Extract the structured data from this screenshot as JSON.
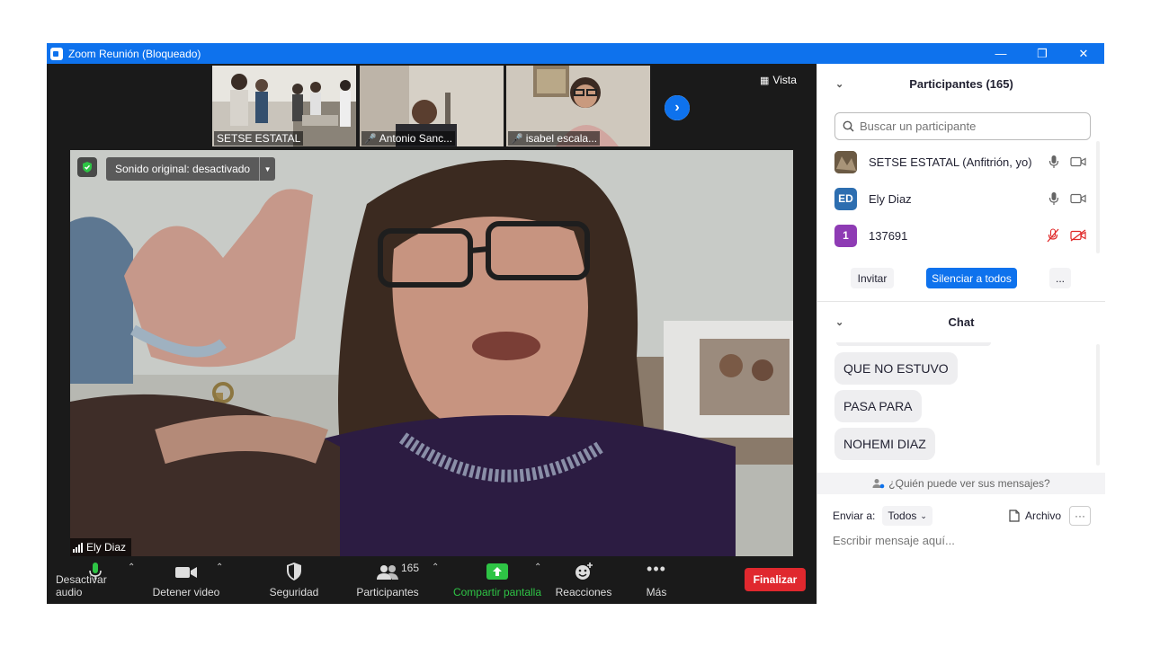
{
  "window": {
    "title": "Zoom Reunión (Bloqueado)",
    "minimize": "—",
    "restore": "❐",
    "close": "✕"
  },
  "thumbnails": [
    {
      "name": "SETSE ESTATAL",
      "muted": false
    },
    {
      "name": "Antonio Sanc...",
      "muted": true
    },
    {
      "name": "isabel escala...",
      "muted": true
    }
  ],
  "view_label": "Vista",
  "main_video": {
    "sound_label": "Sonido original: desactivado",
    "speaker_name": "Ely Diaz"
  },
  "toolbar": {
    "audio_label": "Desactivar audio",
    "video_label": "Detener video",
    "security_label": "Seguridad",
    "participants_label": "Participantes",
    "participants_count": "165",
    "share_label": "Compartir pantalla",
    "reactions_label": "Reacciones",
    "more_label": "Más",
    "end_label": "Finalizar"
  },
  "participants_panel": {
    "title": "Participantes (165)",
    "search_placeholder": "Buscar un participante",
    "list": [
      {
        "name": "SETSE ESTATAL (Anfitrión, yo)",
        "avatar": "",
        "avatar_color": "#6b5a44",
        "muted": false
      },
      {
        "name": "Ely Diaz",
        "avatar": "ED",
        "avatar_color": "#2d6eb0",
        "muted": false
      },
      {
        "name": "137691",
        "avatar": "1",
        "avatar_color": "#8e3bb4",
        "muted": true
      }
    ],
    "invite_label": "Invitar",
    "mute_all_label": "Silenciar a todos",
    "more_label": "..."
  },
  "chat": {
    "title": "Chat",
    "messages": [
      "QUE NO ESTUVO",
      "PASA PARA",
      "NOHEMI DIAZ"
    ],
    "who_can_see": "¿Quién puede ver sus mensajes?",
    "send_to_label": "Enviar a:",
    "send_to_value": "Todos",
    "file_label": "Archivo",
    "more": "···",
    "input_placeholder": "Escribir mensaje aquí..."
  },
  "colors": {
    "accent": "#0e72ed",
    "end": "#e0282e",
    "share": "#2ec445",
    "muted": "#e02828"
  }
}
